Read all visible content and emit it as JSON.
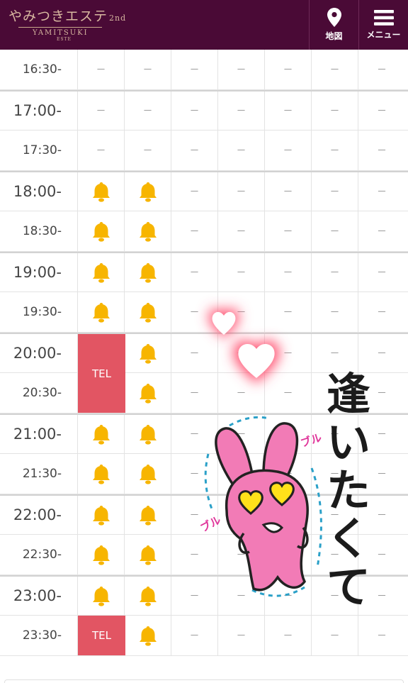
{
  "header": {
    "logo_main": "やみつきエステ",
    "logo_sup": "2nd",
    "logo_sub": "YAMITSUKI",
    "logo_sub2": "ESTE",
    "map_label": "地図",
    "menu_label": "メニュー",
    "map_icon": "map-pin-icon",
    "menu_icon": "hamburger-icon",
    "color": "#4a0a36"
  },
  "colors": {
    "tel": "#e25563",
    "bell": "#f7b500"
  },
  "schedule": {
    "rows": [
      {
        "time": "16:30-",
        "slots": [
          "－",
          "－",
          "－",
          "－",
          "－",
          "－",
          "－"
        ]
      },
      {
        "time": "17:00-",
        "slots": [
          "－",
          "－",
          "－",
          "－",
          "－",
          "－",
          "－"
        ]
      },
      {
        "time": "17:30-",
        "slots": [
          "－",
          "－",
          "－",
          "－",
          "－",
          "－",
          "－"
        ]
      },
      {
        "time": "18:00-",
        "slots": [
          "bell",
          "bell",
          "－",
          "－",
          "－",
          "－",
          "－"
        ]
      },
      {
        "time": "18:30-",
        "slots": [
          "bell",
          "bell",
          "－",
          "－",
          "－",
          "－",
          "－"
        ]
      },
      {
        "time": "19:00-",
        "slots": [
          "bell",
          "bell",
          "－",
          "－",
          "－",
          "－",
          "－"
        ]
      },
      {
        "time": "19:30-",
        "slots": [
          "bell",
          "bell",
          "－",
          "－",
          "－",
          "－",
          "－"
        ]
      },
      {
        "time": "20:00-",
        "slots": [
          "tel",
          "bell",
          "－",
          "－",
          "－",
          "－",
          "－"
        ]
      },
      {
        "time": "20:30-",
        "slots": [
          "tel",
          "bell",
          "－",
          "－",
          "－",
          "－",
          "－"
        ]
      },
      {
        "time": "21:00-",
        "slots": [
          "bell",
          "bell",
          "－",
          "－",
          "－",
          "－",
          "－"
        ]
      },
      {
        "time": "21:30-",
        "slots": [
          "bell",
          "bell",
          "－",
          "－",
          "－",
          "－",
          "－"
        ]
      },
      {
        "time": "22:00-",
        "slots": [
          "bell",
          "bell",
          "－",
          "－",
          "－",
          "－",
          "－"
        ]
      },
      {
        "time": "22:30-",
        "slots": [
          "bell",
          "bell",
          "－",
          "－",
          "－",
          "－",
          "－"
        ]
      },
      {
        "time": "23:00-",
        "slots": [
          "bell",
          "bell",
          "－",
          "－",
          "－",
          "－",
          "－"
        ]
      },
      {
        "time": "23:30-",
        "slots": [
          "tel",
          "bell",
          "－",
          "－",
          "－",
          "－",
          "－"
        ]
      }
    ],
    "tel_label": "TEL"
  },
  "sticker": {
    "text": "逢いたくて",
    "sfx": "ブル",
    "icon": "pink-rabbit-sticker"
  }
}
